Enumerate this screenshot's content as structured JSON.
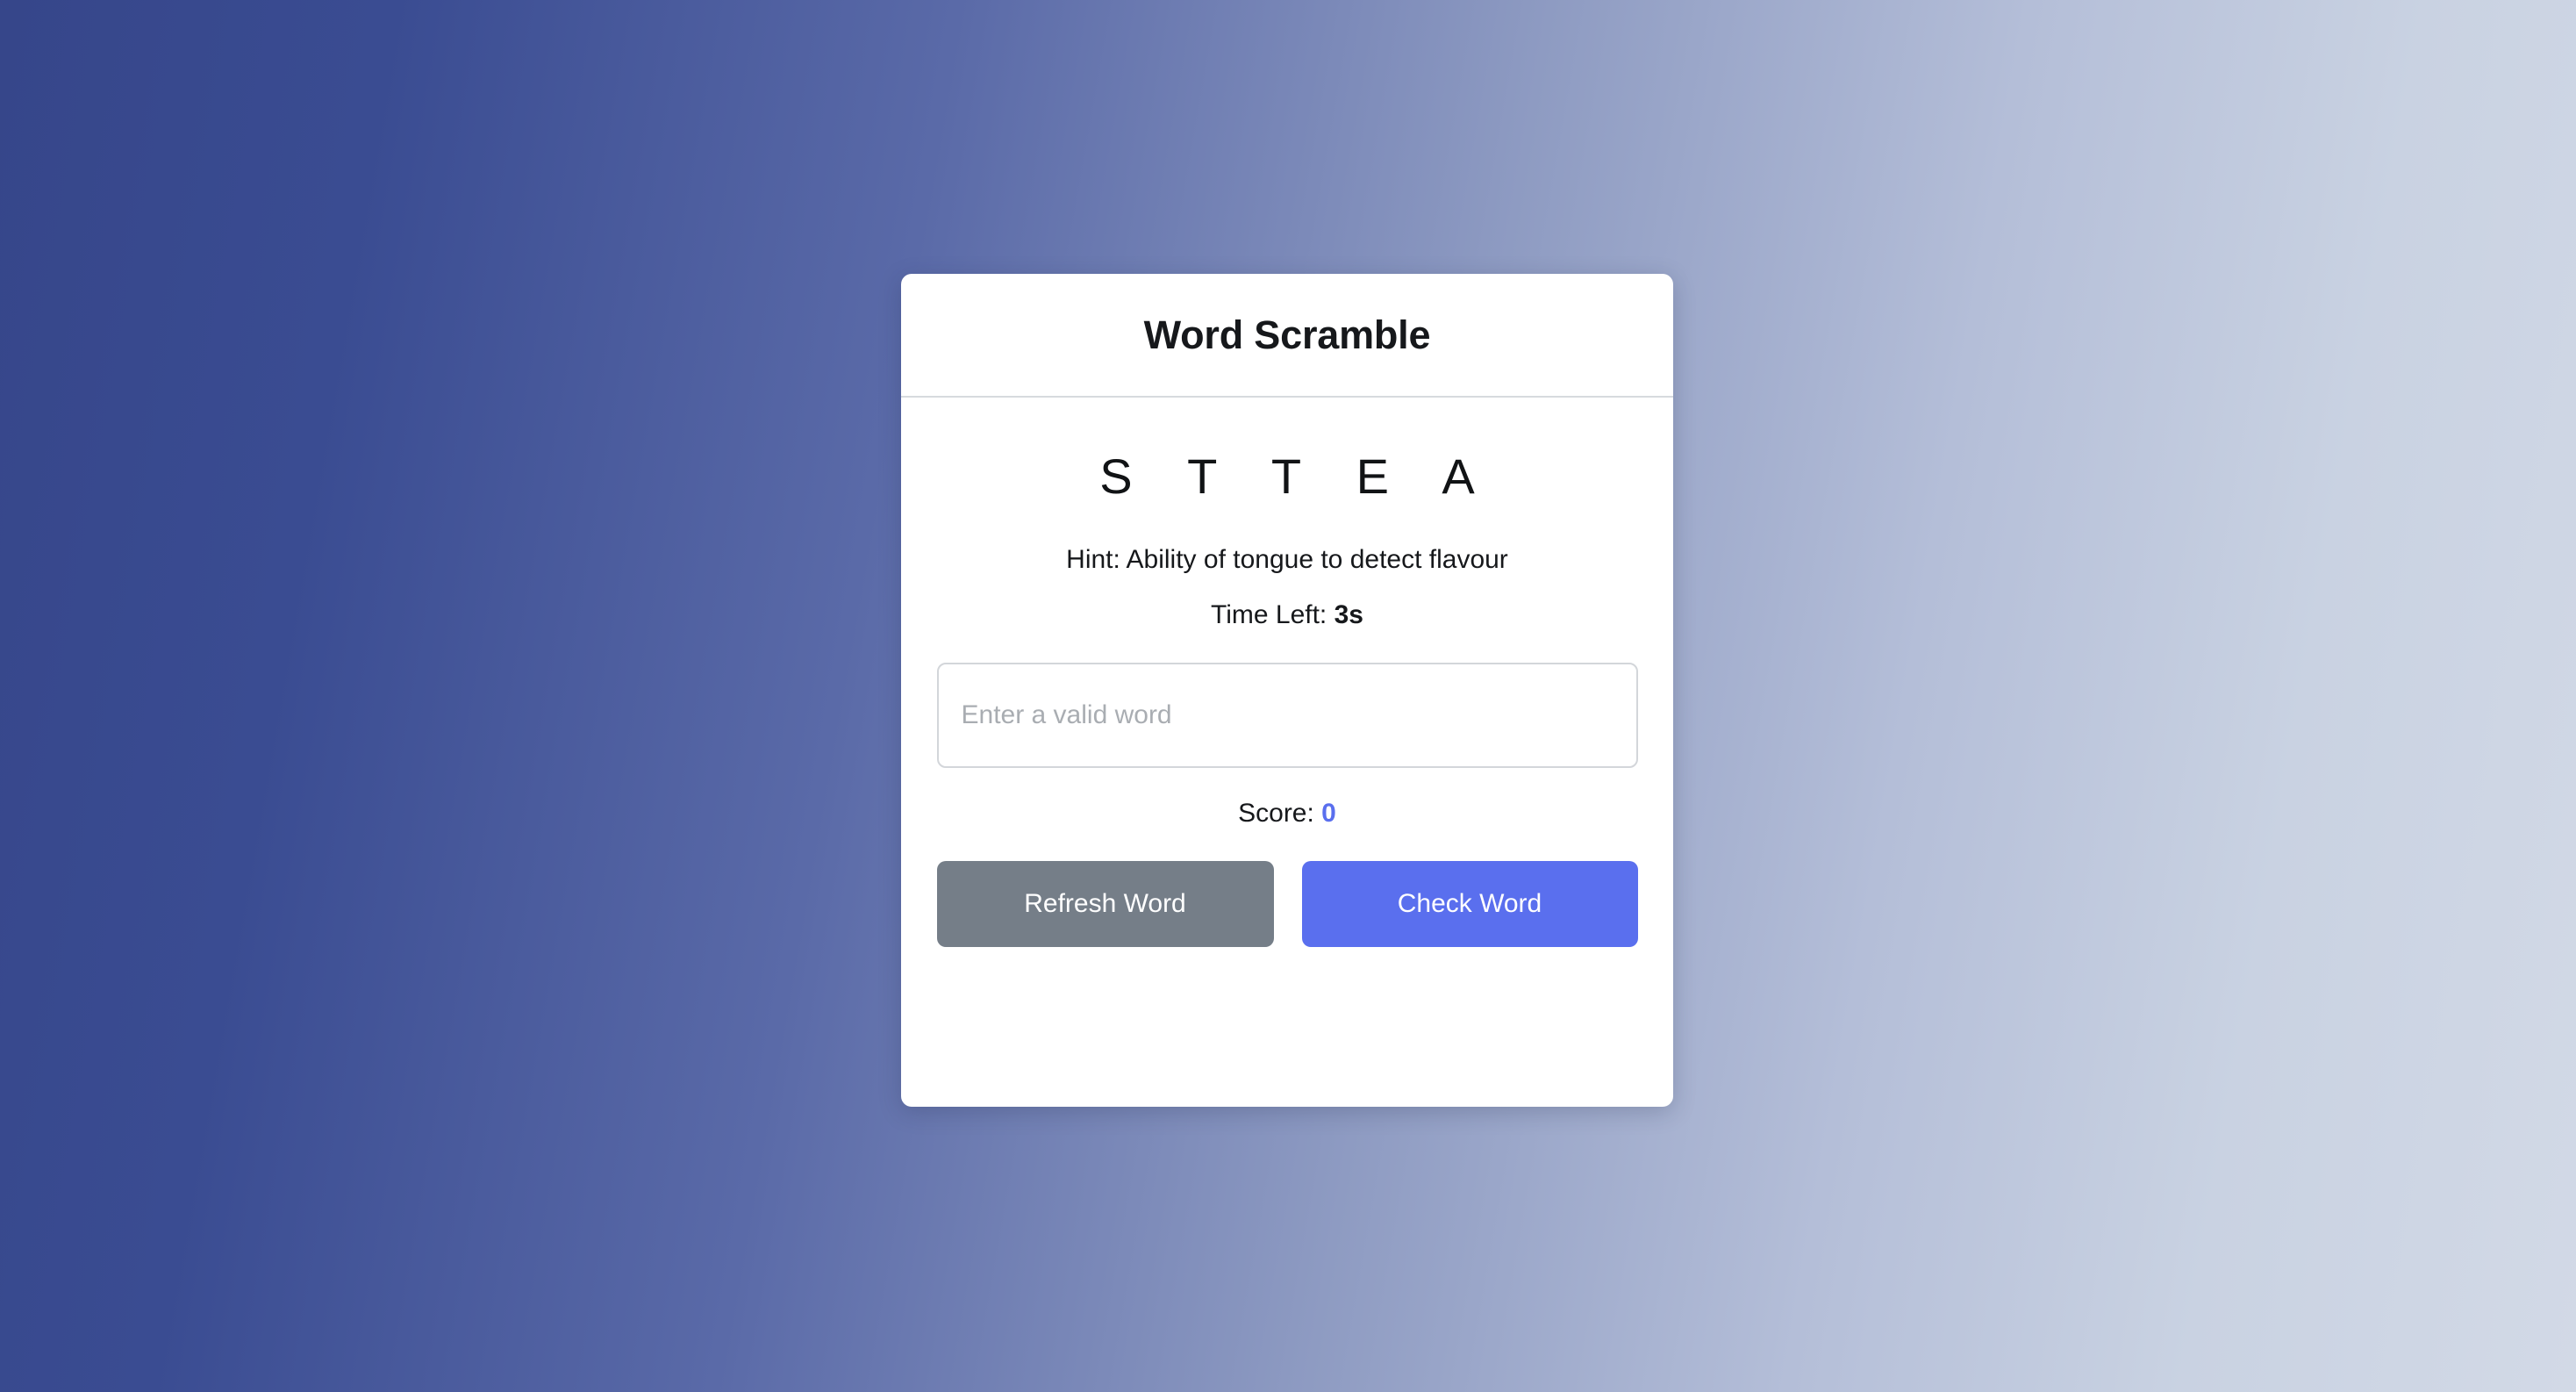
{
  "page": {
    "background_gradient_from": "#36468A",
    "background_gradient_to": "#D2D9E6"
  },
  "card": {
    "title": "Word Scramble",
    "scramble": {
      "letters": [
        "S",
        "T",
        "T",
        "E",
        "A"
      ],
      "display": "S T T E A"
    },
    "hint": {
      "label": "Hint:",
      "text": "Ability of tongue to detect flavour",
      "full": "Hint: Ability of tongue to detect flavour"
    },
    "timer": {
      "label": "Time Left: ",
      "value": "3s",
      "seconds": 3
    },
    "input": {
      "placeholder": "Enter a valid word",
      "value": ""
    },
    "score": {
      "label": "Score: ",
      "value": "0",
      "accent_color": "#5A6FEE"
    },
    "buttons": {
      "refresh_label": "Refresh Word",
      "refresh_color": "#757E88",
      "check_label": "Check Word",
      "check_color": "#5A6FEE"
    }
  }
}
